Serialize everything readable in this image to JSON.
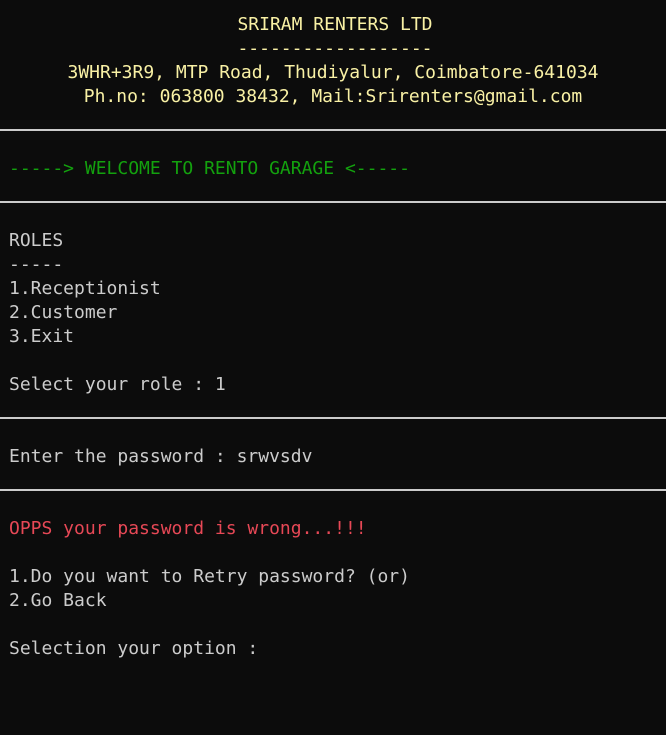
{
  "header": {
    "company_name": "SRIRAM RENTERS LTD",
    "underline": "------------------",
    "address": "3WHR+3R9, MTP Road, Thudiyalur, Coimbatore-641034",
    "contact": "Ph.no: 063800 38432, Mail:Srirenters@gmail.com"
  },
  "welcome": "-----> WELCOME TO RENTO GARAGE <-----",
  "roles": {
    "title": "ROLES",
    "underline": "-----",
    "options": [
      "1.Receptionist",
      "2.Customer",
      "3.Exit"
    ],
    "prompt": "Select your role : 1"
  },
  "password": {
    "prompt": "Enter the password : srwvsdv"
  },
  "error": {
    "message": "OPPS your password is wrong...!!!",
    "options": [
      "1.Do you want to Retry password? (or)",
      "2.Go Back"
    ],
    "prompt": "Selection your option :"
  },
  "colors": {
    "background": "#0c0c0c",
    "text": "#cccccc",
    "header": "#f9f1a5",
    "welcome": "#13a10e",
    "error": "#e74856"
  }
}
